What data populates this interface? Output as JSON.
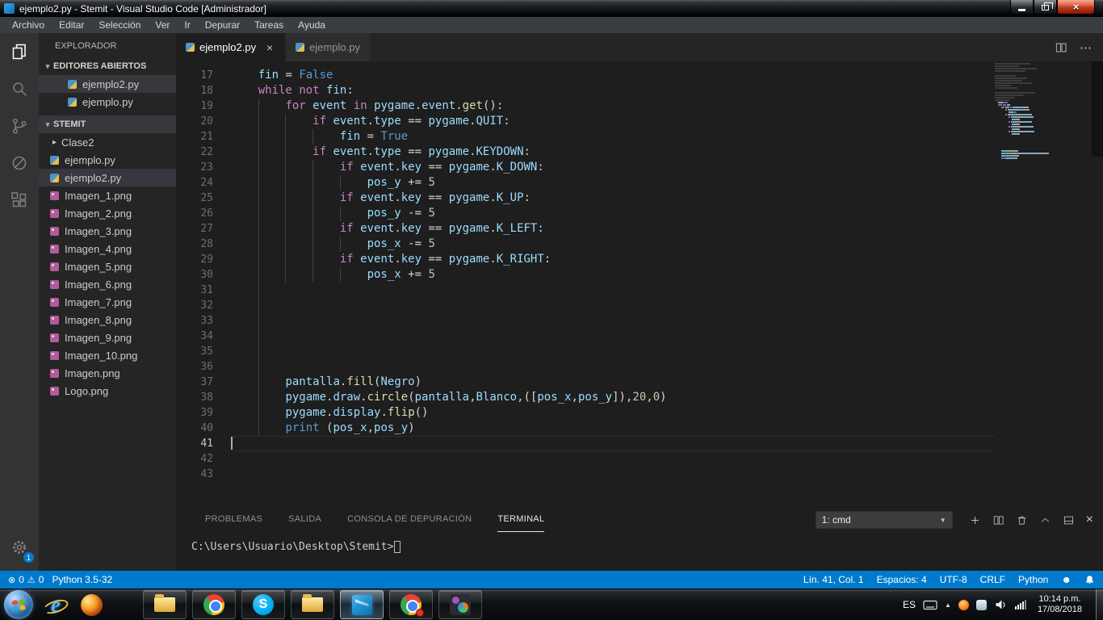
{
  "window": {
    "title": "ejemplo2.py - Stemit - Visual Studio Code [Administrador]"
  },
  "menu": {
    "items": [
      "Archivo",
      "Editar",
      "Selección",
      "Ver",
      "Ir",
      "Depurar",
      "Tareas",
      "Ayuda"
    ]
  },
  "activity_bar": {
    "settings_badge": "1"
  },
  "sidebar": {
    "title": "EXPLORADOR",
    "open_editors": {
      "label": "EDITORES ABIERTOS",
      "items": [
        {
          "name": "ejemplo2.py",
          "selected": true
        },
        {
          "name": "ejemplo.py",
          "selected": false
        }
      ]
    },
    "folder": {
      "label": "STEMIT",
      "items": [
        {
          "name": "Clase2",
          "type": "folder"
        },
        {
          "name": "ejemplo.py",
          "type": "python"
        },
        {
          "name": "ejemplo2.py",
          "type": "python",
          "selected": true
        },
        {
          "name": "Imagen_1.png",
          "type": "image"
        },
        {
          "name": "Imagen_2.png",
          "type": "image"
        },
        {
          "name": "Imagen_3.png",
          "type": "image"
        },
        {
          "name": "Imagen_4.png",
          "type": "image"
        },
        {
          "name": "Imagen_5.png",
          "type": "image"
        },
        {
          "name": "Imagen_6.png",
          "type": "image"
        },
        {
          "name": "Imagen_7.png",
          "type": "image"
        },
        {
          "name": "Imagen_8.png",
          "type": "image"
        },
        {
          "name": "Imagen_9.png",
          "type": "image"
        },
        {
          "name": "Imagen_10.png",
          "type": "image"
        },
        {
          "name": "Imagen.png",
          "type": "image"
        },
        {
          "name": "Logo.png",
          "type": "image"
        }
      ]
    }
  },
  "tabs": [
    {
      "label": "ejemplo2.py",
      "active": true
    },
    {
      "label": "ejemplo.py",
      "active": false
    }
  ],
  "editor": {
    "current_line": 41,
    "lines": [
      {
        "n": 17,
        "t": [
          [
            "    ",
            ""
          ],
          [
            "fin",
            "v"
          ],
          [
            " = ",
            ""
          ],
          [
            "False",
            "b"
          ]
        ]
      },
      {
        "n": 18,
        "t": [
          [
            "    ",
            ""
          ],
          [
            "while",
            "k"
          ],
          [
            " ",
            ""
          ],
          [
            "not",
            "k"
          ],
          [
            " ",
            ""
          ],
          [
            "fin",
            "v"
          ],
          [
            ":",
            ""
          ]
        ]
      },
      {
        "n": 19,
        "t": [
          [
            "        ",
            ""
          ],
          [
            "for",
            "k"
          ],
          [
            " ",
            ""
          ],
          [
            "event",
            "v"
          ],
          [
            " ",
            ""
          ],
          [
            "in",
            "k"
          ],
          [
            " ",
            ""
          ],
          [
            "pygame",
            "v"
          ],
          [
            ".",
            ""
          ],
          [
            "event",
            "v"
          ],
          [
            ".",
            ""
          ],
          [
            "get",
            "f"
          ],
          [
            "():",
            ""
          ]
        ]
      },
      {
        "n": 20,
        "t": [
          [
            "            ",
            ""
          ],
          [
            "if",
            "k"
          ],
          [
            " ",
            ""
          ],
          [
            "event",
            "v"
          ],
          [
            ".",
            ""
          ],
          [
            "type",
            "v"
          ],
          [
            " == ",
            ""
          ],
          [
            "pygame",
            "v"
          ],
          [
            ".",
            ""
          ],
          [
            "QUIT",
            "v"
          ],
          [
            ":",
            ""
          ]
        ]
      },
      {
        "n": 21,
        "t": [
          [
            "                ",
            ""
          ],
          [
            "fin",
            "v"
          ],
          [
            " = ",
            ""
          ],
          [
            "True",
            "b"
          ]
        ]
      },
      {
        "n": 22,
        "t": [
          [
            "            ",
            ""
          ],
          [
            "if",
            "k"
          ],
          [
            " ",
            ""
          ],
          [
            "event",
            "v"
          ],
          [
            ".",
            ""
          ],
          [
            "type",
            "v"
          ],
          [
            " == ",
            ""
          ],
          [
            "pygame",
            "v"
          ],
          [
            ".",
            ""
          ],
          [
            "KEYDOWN",
            "v"
          ],
          [
            ":",
            ""
          ]
        ]
      },
      {
        "n": 23,
        "t": [
          [
            "                ",
            ""
          ],
          [
            "if",
            "k"
          ],
          [
            " ",
            ""
          ],
          [
            "event",
            "v"
          ],
          [
            ".",
            ""
          ],
          [
            "key",
            "v"
          ],
          [
            " == ",
            ""
          ],
          [
            "pygame",
            "v"
          ],
          [
            ".",
            ""
          ],
          [
            "K_DOWN",
            "v"
          ],
          [
            ":",
            ""
          ]
        ]
      },
      {
        "n": 24,
        "t": [
          [
            "                    ",
            ""
          ],
          [
            "pos_y",
            "v"
          ],
          [
            " += ",
            ""
          ],
          [
            "5",
            "n"
          ]
        ]
      },
      {
        "n": 25,
        "t": [
          [
            "                ",
            ""
          ],
          [
            "if",
            "k"
          ],
          [
            " ",
            ""
          ],
          [
            "event",
            "v"
          ],
          [
            ".",
            ""
          ],
          [
            "key",
            "v"
          ],
          [
            " == ",
            ""
          ],
          [
            "pygame",
            "v"
          ],
          [
            ".",
            ""
          ],
          [
            "K_UP",
            "v"
          ],
          [
            ":",
            ""
          ]
        ]
      },
      {
        "n": 26,
        "t": [
          [
            "                    ",
            ""
          ],
          [
            "pos_y",
            "v"
          ],
          [
            " -= ",
            ""
          ],
          [
            "5",
            "n"
          ]
        ]
      },
      {
        "n": 27,
        "t": [
          [
            "                ",
            ""
          ],
          [
            "if",
            "k"
          ],
          [
            " ",
            ""
          ],
          [
            "event",
            "v"
          ],
          [
            ".",
            ""
          ],
          [
            "key",
            "v"
          ],
          [
            " == ",
            ""
          ],
          [
            "pygame",
            "v"
          ],
          [
            ".",
            ""
          ],
          [
            "K_LEFT",
            "v"
          ],
          [
            ":",
            ""
          ]
        ]
      },
      {
        "n": 28,
        "t": [
          [
            "                    ",
            ""
          ],
          [
            "pos_x",
            "v"
          ],
          [
            " -= ",
            ""
          ],
          [
            "5",
            "n"
          ]
        ]
      },
      {
        "n": 29,
        "t": [
          [
            "                ",
            ""
          ],
          [
            "if",
            "k"
          ],
          [
            " ",
            ""
          ],
          [
            "event",
            "v"
          ],
          [
            ".",
            ""
          ],
          [
            "key",
            "v"
          ],
          [
            " == ",
            ""
          ],
          [
            "pygame",
            "v"
          ],
          [
            ".",
            ""
          ],
          [
            "K_RIGHT",
            "v"
          ],
          [
            ":",
            ""
          ]
        ]
      },
      {
        "n": 30,
        "t": [
          [
            "                    ",
            ""
          ],
          [
            "pos_x",
            "v"
          ],
          [
            " += ",
            ""
          ],
          [
            "5",
            "n"
          ]
        ]
      },
      {
        "n": 31,
        "t": []
      },
      {
        "n": 32,
        "t": []
      },
      {
        "n": 33,
        "t": []
      },
      {
        "n": 34,
        "t": []
      },
      {
        "n": 35,
        "t": []
      },
      {
        "n": 36,
        "t": []
      },
      {
        "n": 37,
        "t": [
          [
            "        ",
            ""
          ],
          [
            "pantalla",
            "v"
          ],
          [
            ".",
            ""
          ],
          [
            "fill",
            "f"
          ],
          [
            "(",
            ""
          ],
          [
            "Negro",
            "v"
          ],
          [
            ")",
            ""
          ]
        ]
      },
      {
        "n": 38,
        "t": [
          [
            "        ",
            ""
          ],
          [
            "pygame",
            "v"
          ],
          [
            ".",
            ""
          ],
          [
            "draw",
            "v"
          ],
          [
            ".",
            ""
          ],
          [
            "circle",
            "f"
          ],
          [
            "(",
            ""
          ],
          [
            "pantalla",
            "v"
          ],
          [
            ",",
            ""
          ],
          [
            "Blanco",
            "v"
          ],
          [
            ",([",
            ""
          ],
          [
            "pos_x",
            "v"
          ],
          [
            ",",
            ""
          ],
          [
            "pos_y",
            "v"
          ],
          [
            "]),",
            ""
          ],
          [
            "20",
            "n"
          ],
          [
            ",",
            ""
          ],
          [
            "0",
            "n"
          ],
          [
            ")",
            ""
          ]
        ]
      },
      {
        "n": 39,
        "t": [
          [
            "        ",
            ""
          ],
          [
            "pygame",
            "v"
          ],
          [
            ".",
            ""
          ],
          [
            "display",
            "v"
          ],
          [
            ".",
            ""
          ],
          [
            "flip",
            "f"
          ],
          [
            "()",
            ""
          ]
        ]
      },
      {
        "n": 40,
        "t": [
          [
            "        ",
            ""
          ],
          [
            "print",
            "b"
          ],
          [
            " (",
            ""
          ],
          [
            "pos_x",
            "v"
          ],
          [
            ",",
            ""
          ],
          [
            "pos_y",
            "v"
          ],
          [
            ")",
            ""
          ]
        ]
      },
      {
        "n": 41,
        "t": []
      },
      {
        "n": 42,
        "t": []
      },
      {
        "n": 43,
        "t": []
      }
    ]
  },
  "panel": {
    "tabs": [
      {
        "label": "PROBLEMAS",
        "active": false
      },
      {
        "label": "SALIDA",
        "active": false
      },
      {
        "label": "CONSOLA DE DEPURACIÓN",
        "active": false
      },
      {
        "label": "TERMINAL",
        "active": true
      }
    ],
    "terminal_select": "1: cmd",
    "terminal_prompt": "C:\\Users\\Usuario\\Desktop\\Stemit>"
  },
  "status_bar": {
    "errors": "0",
    "warnings": "0",
    "interpreter": "Python 3.5-32",
    "line_col": "Lín. 41, Col. 1",
    "indent": "Espacios: 4",
    "encoding": "UTF-8",
    "eol": "CRLF",
    "language": "Python"
  },
  "taskbar": {
    "quick_launch": [
      "internet-explorer",
      "firefox"
    ],
    "apps": [
      {
        "name": "windows-explorer"
      },
      {
        "name": "chrome"
      },
      {
        "name": "skype"
      },
      {
        "name": "folder"
      },
      {
        "name": "vscode",
        "active": true
      },
      {
        "name": "chrome-profile"
      },
      {
        "name": "media-player"
      }
    ],
    "tray": {
      "language": "ES",
      "time": "10:14 p.m.",
      "date": "17/08/2018"
    }
  },
  "icons": {
    "close": "×",
    "chevron_down": "▾",
    "chevron_right": "▸",
    "ellipsis": "⋯",
    "dropdown": "▼",
    "error": "⊗",
    "warning": "⚠",
    "smiley": "☻",
    "hidden_icons": "▲"
  }
}
